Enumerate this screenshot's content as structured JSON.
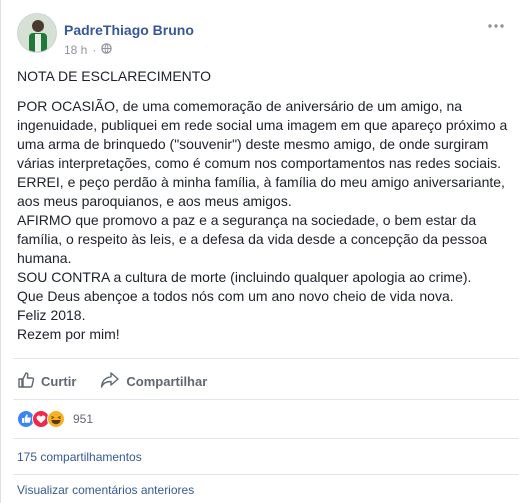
{
  "post": {
    "author": "PadreThiago Bruno",
    "time": "18 h",
    "separator": "·",
    "paragraphs": [
      "NOTA DE ESCLARECIMENTO",
      "POR OCASIÃO, de uma comemoração de aniversário de um amigo, na ingenuidade, publiquei em rede social uma imagem em que apareço próximo a uma arma de brinquedo (\"souvenir\") deste mesmo amigo, de onde surgiram várias interpretações, como é comum nos comportamentos nas redes sociais.",
      "ERREI, e peço perdão à minha família, à família do meu amigo aniversariante, aos meus paroquianos, e aos meus amigos.",
      "AFIRMO que promovo a paz e a segurança na sociedade, o bem estar da família, o respeito às leis, e a defesa da vida desde a concepção da pessoa humana.",
      "SOU CONTRA a cultura de morte (incluindo qualquer apologia ao crime).",
      "Que Deus abençoe a todos nós com um ano novo cheio de vida nova.",
      "Feliz 2018.",
      "Rezem por mim!"
    ]
  },
  "actions": {
    "like_label": "Curtir",
    "share_label": "Compartilhar"
  },
  "reactions": {
    "count": "951",
    "types": [
      "like-icon",
      "love-icon",
      "haha-icon"
    ],
    "colors": {
      "like": "#3b86f6",
      "love": "#f0284a",
      "haha": "#f7b125"
    }
  },
  "footer": {
    "shares_label": "175 compartilhamentos",
    "view_comments_label": "Visualizar comentários anteriores"
  },
  "colors": {
    "link": "#365899",
    "muted": "#90949c",
    "text": "#1d2129"
  }
}
